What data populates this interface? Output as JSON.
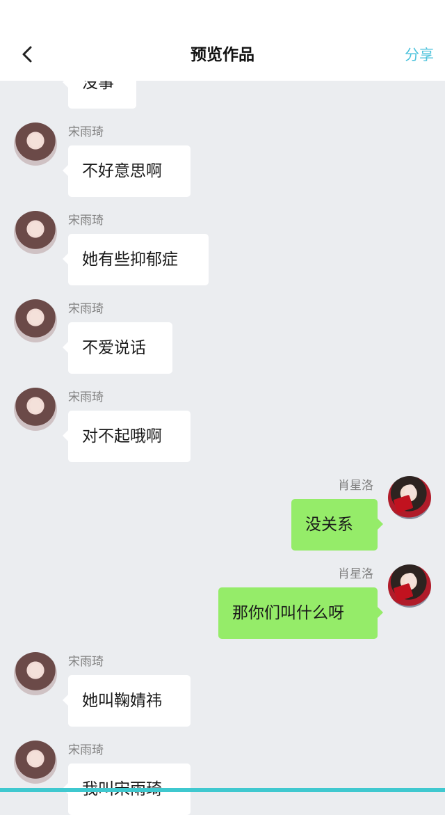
{
  "header": {
    "title": "预览作品",
    "share_label": "分享",
    "back_icon": "chevron-left-icon",
    "accent_color": "#4fc3dc"
  },
  "colors": {
    "background": "#ebedf0",
    "incoming_bubble": "#ffffff",
    "outgoing_bubble": "#95ec69"
  },
  "messages": [
    {
      "side": "left",
      "sender": "",
      "text": "没事"
    },
    {
      "side": "left",
      "sender": "宋雨琦",
      "text": "不好意思啊"
    },
    {
      "side": "left",
      "sender": "宋雨琦",
      "text": "她有些抑郁症"
    },
    {
      "side": "left",
      "sender": "宋雨琦",
      "text": "不爱说话"
    },
    {
      "side": "left",
      "sender": "宋雨琦",
      "text": "对不起哦啊"
    },
    {
      "side": "right",
      "sender": "肖星洛",
      "text": "没关系"
    },
    {
      "side": "right",
      "sender": "肖星洛",
      "text": "那你们叫什么呀"
    },
    {
      "side": "left",
      "sender": "宋雨琦",
      "text": "她叫鞠婧祎"
    },
    {
      "side": "left",
      "sender": "宋雨琦",
      "text": "我叫宋雨琦"
    }
  ]
}
